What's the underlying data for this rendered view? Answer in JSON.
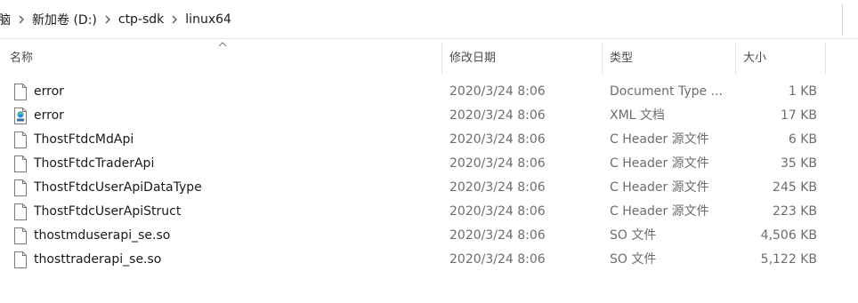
{
  "breadcrumb": {
    "items": [
      {
        "label": "脑"
      },
      {
        "label": "新加卷 (D:)"
      },
      {
        "label": "ctp-sdk"
      },
      {
        "label": "linux64"
      }
    ]
  },
  "columns": {
    "name": "名称",
    "date": "修改日期",
    "type": "类型",
    "size": "大小"
  },
  "files": [
    {
      "name": "error",
      "date": "2020/3/24 8:06",
      "type": "Document Type ...",
      "size": "1 KB",
      "icon": "document-file-icon"
    },
    {
      "name": "error",
      "date": "2020/3/24 8:06",
      "type": "XML 文档",
      "size": "17 KB",
      "icon": "xml-file-icon"
    },
    {
      "name": "ThostFtdcMdApi",
      "date": "2020/3/24 8:06",
      "type": "C Header 源文件",
      "size": "6 KB",
      "icon": "document-file-icon"
    },
    {
      "name": "ThostFtdcTraderApi",
      "date": "2020/3/24 8:06",
      "type": "C Header 源文件",
      "size": "35 KB",
      "icon": "document-file-icon"
    },
    {
      "name": "ThostFtdcUserApiDataType",
      "date": "2020/3/24 8:06",
      "type": "C Header 源文件",
      "size": "245 KB",
      "icon": "document-file-icon"
    },
    {
      "name": "ThostFtdcUserApiStruct",
      "date": "2020/3/24 8:06",
      "type": "C Header 源文件",
      "size": "223 KB",
      "icon": "document-file-icon"
    },
    {
      "name": "thostmduserapi_se.so",
      "date": "2020/3/24 8:06",
      "type": "SO 文件",
      "size": "4,506 KB",
      "icon": "document-file-icon"
    },
    {
      "name": "thosttraderapi_se.so",
      "date": "2020/3/24 8:06",
      "type": "SO 文件",
      "size": "5,122 KB",
      "icon": "document-file-icon"
    }
  ]
}
